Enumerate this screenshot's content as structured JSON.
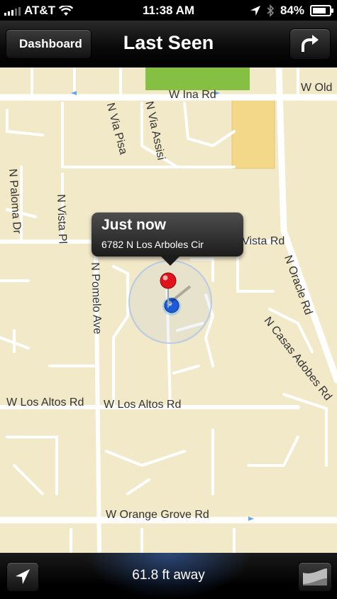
{
  "status_bar": {
    "carrier": "AT&T",
    "time": "11:38 AM",
    "battery": "84%",
    "battery_level": 0.84,
    "icons": [
      "signal-bars-icon",
      "wifi-icon",
      "location-arrow-icon",
      "bluetooth-icon",
      "battery-icon"
    ]
  },
  "nav": {
    "back_label": "Dashboard",
    "title": "Last Seen",
    "action_icon": "share-arrow-icon"
  },
  "map": {
    "roads": [
      "W Ina Rd",
      "N Via Pisa",
      "N Via Assisi",
      "N Paloma Dr",
      "N Vista Pl",
      "N Pomelo Ave",
      "W Oracle Vista Rd",
      "N Oracle Rd",
      "N Casas Adobes Rd",
      "W Los Altos Rd",
      "W Los Altos Rd",
      "W Orange Grove Rd",
      "W Old"
    ],
    "pin": {
      "title": "Just now",
      "address": "6782 N Los Arboles Cir"
    },
    "colors": {
      "land": "#f2e9c9",
      "road": "#ffffff",
      "park": "#8bc34a",
      "commercial": "#f4d88a",
      "pin_head": "#e0141b",
      "user_dot": "#1e5bd8"
    }
  },
  "toolbar": {
    "location_icon": "location-arrow-icon",
    "distance": "61.8 ft away",
    "curl_icon": "page-curl-icon"
  }
}
